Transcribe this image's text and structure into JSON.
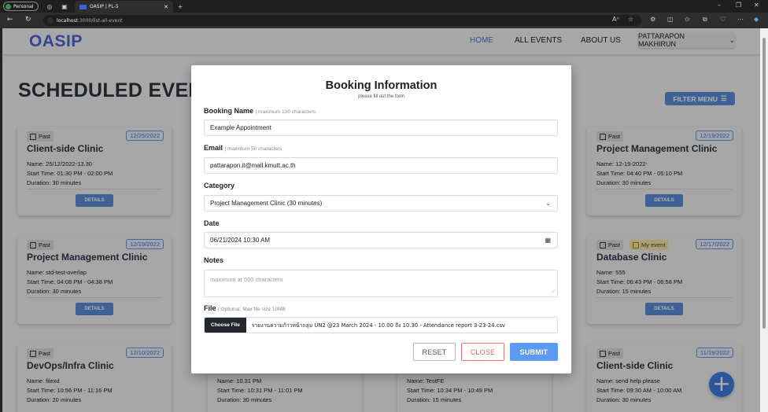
{
  "browser": {
    "profile": "Personal",
    "tab_title": "OASIP | PL-5",
    "url_host": "localhost",
    "url_path": ":3000/list-all-event"
  },
  "app": {
    "logo": "OASIP",
    "nav": [
      "HOME",
      "ALL EVENTS",
      "ABOUT US"
    ],
    "user": "PATTARAPON MAKHIRUN",
    "headline": "SCHEDULED EVENTS",
    "filter_label": "FILTER MENU"
  },
  "cards": [
    {
      "status": "Past",
      "date": "12/25/2022",
      "title": "Client-side Clinic",
      "name": "Name: 25/12/2022-13.30",
      "time": "Start Time: 01:30 PM - 02:00 PM",
      "duration": "Duration: 30 minutes",
      "button": "DETAILS"
    },
    {
      "status": "Past",
      "date": "12/19/2022",
      "title": "Project Management Clinic",
      "name": "Name: 12-19-2022-",
      "time": "Start Time: 04:40 PM - 05:10 PM",
      "duration": "Duration: 30 minutes",
      "button": "DETAILS"
    },
    {
      "status": "Past",
      "date": "12/19/2022",
      "title": "Project Management Clinic",
      "name": "Name: std-test-overlap",
      "time": "Start Time: 04:08 PM - 04:38 PM",
      "duration": "Duration: 30 minutes",
      "button": "DETAILS"
    },
    {
      "status": "Past",
      "mine": "My event",
      "date": "12/17/2022",
      "title": "Database Clinic",
      "name": "Name: 555",
      "time": "Start Time: 06:43 PM - 06:58 PM",
      "duration": "Duration: 15 minutes",
      "button": "DETAILS"
    },
    {
      "status": "Past",
      "date": "12/10/2022",
      "title": "DevOps/Infra Clinic",
      "name": "Name: filexd",
      "time": "Start Time: 10:56 PM - 11:16 PM",
      "duration": "Duration: 20 minutes"
    },
    {
      "name": "Name: 10.31 PM",
      "time": "Start Time: 10:31 PM - 11:01 PM",
      "duration": "Duration: 30 minutes"
    },
    {
      "name": "Name: TestFE",
      "time": "Start Time: 10:34 PM - 10:49 PM",
      "duration": "Duration: 15 minutes"
    },
    {
      "status": "Past",
      "date": "11/19/2022",
      "title": "Client-side Clinic",
      "name": "Name: send help please",
      "time": "Start Time: 09:30 AM - 10:00 AM",
      "duration": "Duration: 30 minutes"
    }
  ],
  "modal": {
    "title": "Booking Information",
    "subtitle": "please fill out the form",
    "booking_name": {
      "label": "Booking Name",
      "hint": "| maximum 100 characters",
      "value": "Example Appointment"
    },
    "email": {
      "label": "Email",
      "hint": "| maximum 50 characters",
      "value": "pattarapon.it@mail.kmutt.ac.th"
    },
    "category": {
      "label": "Category",
      "value": "Project Management Clinic (30 minutes)"
    },
    "date": {
      "label": "Date",
      "value": "06/21/2024 10:30 AM"
    },
    "notes": {
      "label": "Notes",
      "placeholder": "maximum at 500 characters"
    },
    "file": {
      "label": "File",
      "hint": "| Optional, Max file size 10MB",
      "button": "Choose File",
      "filename": "รายงานความก้าวหน้ากลุ่ม UN2 @23 March 2024 - 10.00 ถึง 10.30 - Attendance report 3-23-24.csv"
    },
    "buttons": {
      "reset": "RESET",
      "close": "CLOSE",
      "submit": "SUBMIT"
    }
  }
}
